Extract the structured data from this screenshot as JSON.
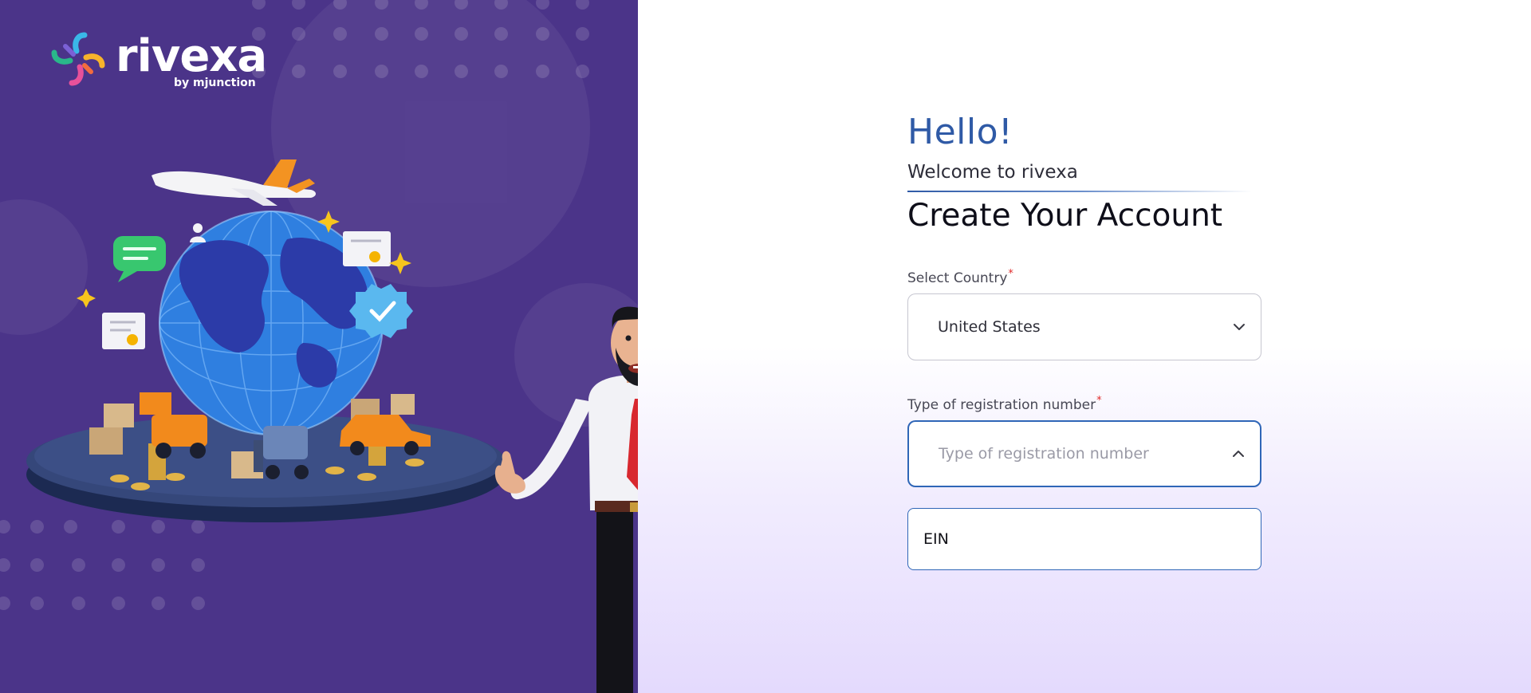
{
  "brand": {
    "name": "rivexa",
    "tagline": "by mjunction"
  },
  "form": {
    "greeting": "Hello!",
    "welcome": "Welcome to rivexa",
    "heading": "Create Your Account",
    "country": {
      "label": "Select Country",
      "required_mark": "*",
      "value": "United States",
      "icon": "chevron-down-icon"
    },
    "registration_type": {
      "label": "Type of registration number",
      "required_mark": "*",
      "placeholder": "Type of registration number",
      "icon": "chevron-up-icon",
      "options": [
        "EIN"
      ]
    }
  },
  "colors": {
    "hero_bg": "#4b3489",
    "accent": "#2f5aa6",
    "required": "#e12b2b",
    "focus_border": "#2f66b7"
  }
}
